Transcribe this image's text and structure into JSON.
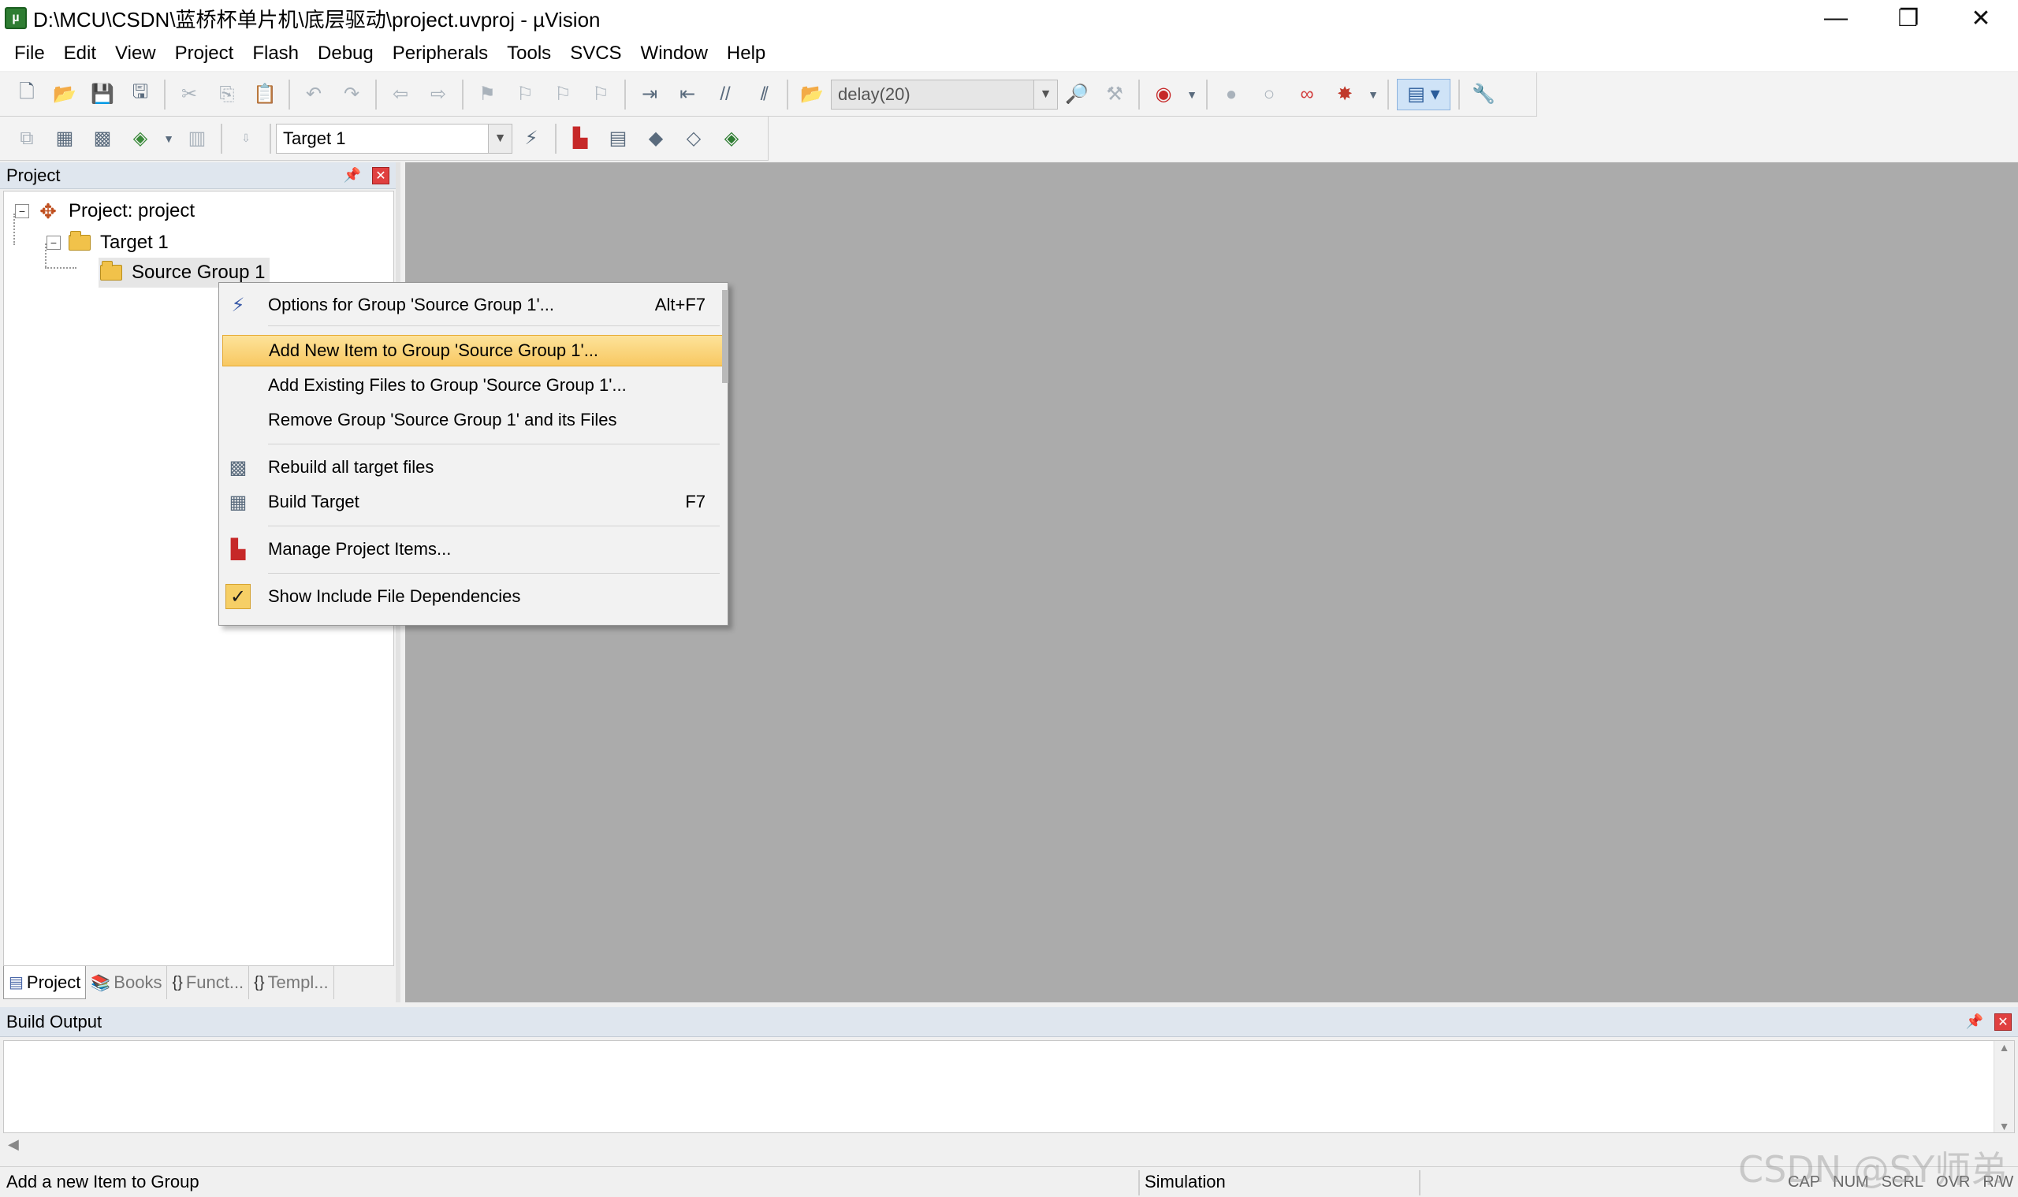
{
  "window": {
    "title": "D:\\MCU\\CSDN\\蓝桥杯单片机\\底层驱动\\project.uvproj - µVision",
    "minimize_glyph": "—",
    "maximize_glyph": "❐",
    "close_glyph": "✕"
  },
  "menu": [
    "File",
    "Edit",
    "View",
    "Project",
    "Flash",
    "Debug",
    "Peripherals",
    "Tools",
    "SVCS",
    "Window",
    "Help"
  ],
  "toolbar1": {
    "find_combo_value": "delay(20)",
    "icons": [
      "new-file-icon",
      "open-file-icon",
      "save-icon",
      "save-all-icon",
      "cut-icon",
      "copy-icon",
      "paste-icon",
      "undo-icon",
      "redo-icon",
      "navigate-back-icon",
      "navigate-forward-icon",
      "bookmark-icon",
      "prev-bookmark-icon",
      "next-bookmark-icon",
      "clear-bookmarks-icon",
      "indent-icon",
      "unindent-icon",
      "comment-icon",
      "uncomment-icon",
      "find-in-files-icon",
      "find-icon",
      "incremental-find-icon",
      "debug-session-icon",
      "breakpoint-icon",
      "disable-breakpoint-icon",
      "disable-all-breakpoints-icon",
      "kill-all-breakpoints-icon",
      "window-layout-icon",
      "configure-icon"
    ]
  },
  "toolbar2": {
    "target_combo_value": "Target 1",
    "icons": [
      "translate-icon",
      "build-icon",
      "rebuild-icon",
      "batch-build-icon",
      "stop-build-icon",
      "download-icon",
      "target-options-icon",
      "manage-components-icon",
      "select-packs-icon",
      "software-packs-icon",
      "pack-installer-icon",
      "manage-run-time-icon"
    ]
  },
  "project_panel": {
    "title": "Project",
    "tree": {
      "root": "Project: project",
      "target": "Target 1",
      "group": "Source Group 1"
    },
    "tabs": [
      {
        "label": "Project",
        "icon": "project-tab-icon"
      },
      {
        "label": "Books",
        "icon": "books-tab-icon"
      },
      {
        "label": "Funct...",
        "icon": "functions-tab-icon"
      },
      {
        "label": "Templ...",
        "icon": "templates-tab-icon"
      }
    ]
  },
  "context_menu": {
    "items": [
      {
        "label": "Options for Group 'Source Group 1'...",
        "shortcut": "Alt+F7",
        "icon": "options-wand-icon"
      },
      {
        "label": "Add New  Item to Group 'Source Group 1'...",
        "shortcut": "",
        "icon": "",
        "highlighted": true
      },
      {
        "label": "Add Existing Files to Group 'Source Group 1'...",
        "shortcut": "",
        "icon": ""
      },
      {
        "label": "Remove Group 'Source Group 1' and its Files",
        "shortcut": "",
        "icon": ""
      },
      {
        "label": "Rebuild all target files",
        "shortcut": "",
        "icon": "rebuild-icon"
      },
      {
        "label": "Build Target",
        "shortcut": "F7",
        "icon": "build-icon"
      },
      {
        "label": "Manage Project Items...",
        "shortcut": "",
        "icon": "manage-project-items-icon"
      },
      {
        "label": "Show Include File Dependencies",
        "shortcut": "",
        "icon": "checkmark-icon",
        "checked": true
      }
    ]
  },
  "build_output": {
    "title": "Build Output"
  },
  "statusbar": {
    "message": "Add a new Item to Group",
    "mode": "Simulation",
    "keys": [
      "CAP",
      "NUM",
      "SCRL",
      "OVR",
      "R/W"
    ]
  },
  "watermark": "CSDN @SY师弟",
  "colors": {
    "menu_highlight": "#f8c862",
    "editor_background": "#ababab",
    "panel_header": "#dfe6ee",
    "close_button": "#e04040"
  }
}
